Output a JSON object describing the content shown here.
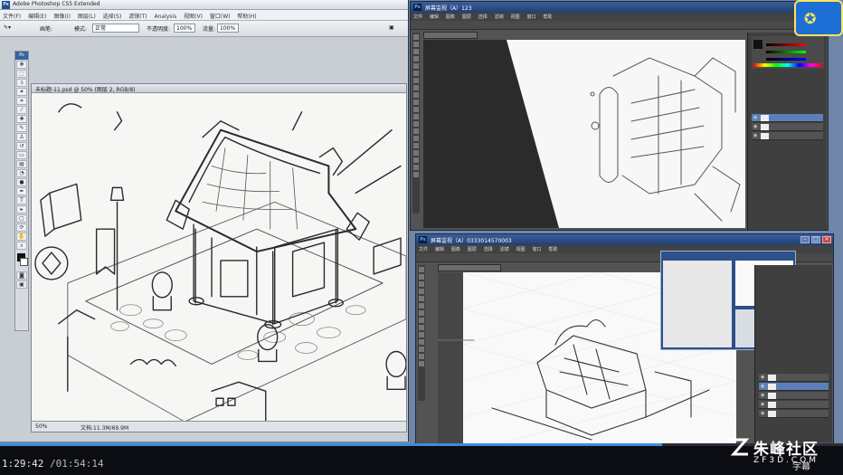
{
  "main_ps": {
    "title": "Adobe Photoshop CS5 Extended",
    "logo": "Ps",
    "menu": [
      "文件(F)",
      "编辑(E)",
      "图像(I)",
      "图层(L)",
      "选择(S)",
      "滤镜(T)",
      "Analysis",
      "视图(V)",
      "窗口(W)",
      "帮助(H)"
    ],
    "options": {
      "brush_label": "画笔:",
      "mode_label": "模式:",
      "mode_value": "正常",
      "opacity_label": "不透明度:",
      "opacity_value": "100%",
      "flow_label": "流量:",
      "flow_value": "100%"
    },
    "toolbox_label": "Ps",
    "document_tab": "未标题-11.psd @ 50% (图层 2, RGB/8)",
    "status": {
      "zoom": "50%",
      "doc_size": "文档:11.3M/69.9M"
    }
  },
  "tr_ps": {
    "title": "屏幕监视（A）123",
    "logo": "Ps",
    "menu": [
      "文件",
      "编辑",
      "图像",
      "图层",
      "选择",
      "滤镜",
      "视图",
      "窗口",
      "帮助"
    ]
  },
  "br_ps": {
    "title": "屏幕监视（A）0333014570003",
    "logo": "Ps",
    "menu": [
      "文件",
      "编辑",
      "图像",
      "图层",
      "选择",
      "滤镜",
      "视图",
      "窗口",
      "帮助"
    ]
  },
  "player": {
    "current_time": "1:29:42",
    "total_time": "/01:54:14",
    "progress": 0.785,
    "subtitle_button": "字幕"
  },
  "watermark": {
    "cn": "朱峰社区",
    "en": "ZF3D.COM"
  },
  "colors": {
    "ps_blue": "#3b5e9a",
    "progress": "#3b8ce0",
    "sketch_paper": "#f4f4f2"
  }
}
